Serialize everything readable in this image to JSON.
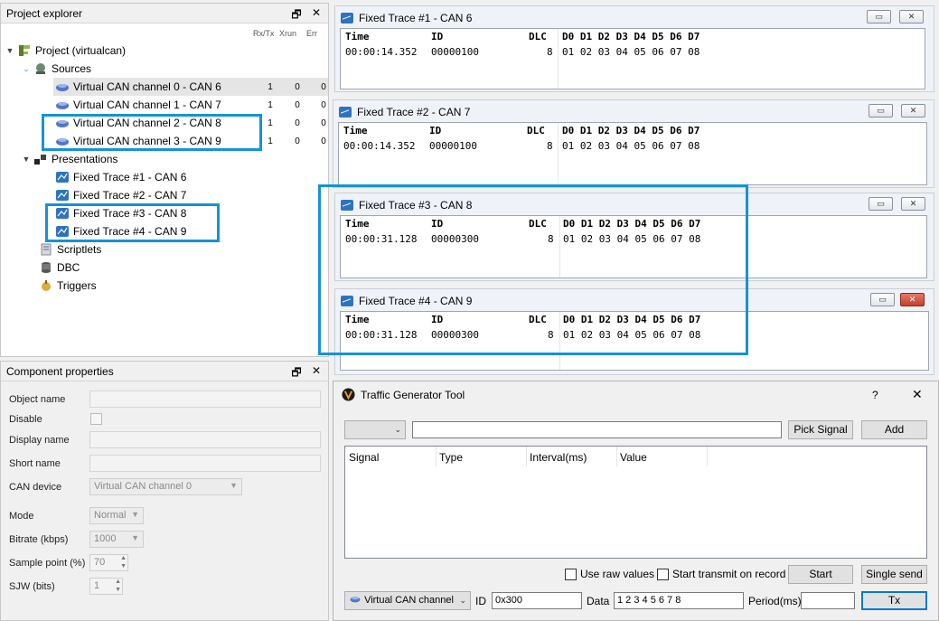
{
  "explorer": {
    "title": "Project explorer",
    "columns": [
      "Rx/Tx",
      "Xrun",
      "Err"
    ],
    "project": "Project (virtualcan)",
    "sources_label": "Sources",
    "channels": [
      {
        "label": "Virtual CAN channel 0 - CAN 6",
        "rx": "1",
        "xrun": "0",
        "err": "0"
      },
      {
        "label": "Virtual CAN channel 1 - CAN 7",
        "rx": "1",
        "xrun": "0",
        "err": "0"
      },
      {
        "label": "Virtual CAN channel 2 - CAN 8",
        "rx": "1",
        "xrun": "0",
        "err": "0"
      },
      {
        "label": "Virtual CAN channel 3 - CAN 9",
        "rx": "1",
        "xrun": "0",
        "err": "0"
      }
    ],
    "presentations_label": "Presentations",
    "presentations": [
      "Fixed Trace #1 - CAN 6",
      "Fixed Trace #2 - CAN 7",
      "Fixed Trace #3 - CAN 8",
      "Fixed Trace #4 - CAN 9"
    ],
    "scriptlets": "Scriptlets",
    "dbc": "DBC",
    "triggers": "Triggers"
  },
  "panel_buttons": {
    "float": "🗗",
    "close": "✕"
  },
  "properties": {
    "title": "Component properties",
    "object_name": "Object name",
    "disable": "Disable",
    "display_name": "Display name",
    "short_name": "Short name",
    "can_device": "CAN device",
    "can_device_value": "Virtual CAN channel 0",
    "mode": "Mode",
    "mode_value": "Normal",
    "bitrate": "Bitrate (kbps)",
    "bitrate_value": "1000",
    "sample_point": "Sample point (%)",
    "sample_point_value": "70",
    "sjw": "SJW (bits)",
    "sjw_value": "1"
  },
  "trace_columns": {
    "time": "Time",
    "id": "ID",
    "dlc": "DLC",
    "data": "D0 D1 D2 D3 D4 D5 D6 D7"
  },
  "traces": [
    {
      "title": "Fixed Trace #1 - CAN 6",
      "time": "00:00:14.352",
      "id": "00000100",
      "dlc": "8",
      "data": "01 02 03 04 05 06 07 08"
    },
    {
      "title": "Fixed Trace #2 - CAN 7",
      "time": "00:00:14.352",
      "id": "00000100",
      "dlc": "8",
      "data": "01 02 03 04 05 06 07 08"
    },
    {
      "title": "Fixed Trace #3 - CAN 8",
      "time": "00:00:31.128",
      "id": "00000300",
      "dlc": "8",
      "data": "01 02 03 04 05 06 07 08"
    },
    {
      "title": "Fixed Trace #4 - CAN 9",
      "time": "00:00:31.128",
      "id": "00000300",
      "dlc": "8",
      "data": "01 02 03 04 05 06 07 08"
    }
  ],
  "traffic": {
    "title": "Traffic Generator Tool",
    "help": "?",
    "close": "✕",
    "pick_signal": "Pick Signal",
    "add": "Add",
    "columns": [
      "Signal",
      "Type",
      "Interval(ms)",
      "Value"
    ],
    "use_raw": "Use raw values",
    "start_on_record": "Start transmit on record",
    "start": "Start",
    "single_send": "Single send",
    "channel": "Virtual CAN channel",
    "id_label": "ID",
    "id_value": "0x300",
    "data_label": "Data",
    "data_value": "1 2 3 4 5 6 7 8",
    "period_label": "Period(ms)",
    "tx": "Tx"
  },
  "colors": {
    "highlight": "#1493d8",
    "accent": "#0078d7"
  }
}
